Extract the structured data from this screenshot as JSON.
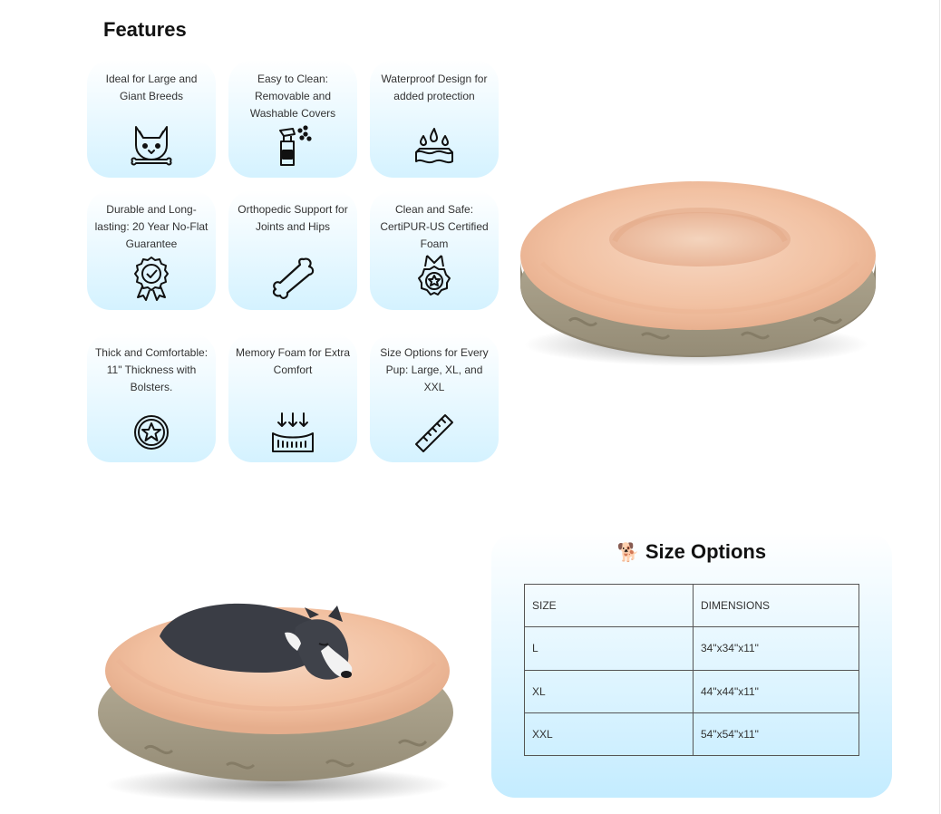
{
  "features": {
    "title": "Features",
    "items": [
      {
        "label": "Ideal for Large and Giant Breeds",
        "icon": "dog-with-bone-icon"
      },
      {
        "label": "Easy to Clean: Removable and Washable Covers",
        "icon": "spray-bottle-icon"
      },
      {
        "label": "Waterproof Design for added protection",
        "icon": "water-drops-icon"
      },
      {
        "label": "Durable and Long-lasting: 20 Year No-Flat Guarantee",
        "icon": "award-badge-icon"
      },
      {
        "label": "Orthopedic Support for Joints and Hips",
        "icon": "bone-icon"
      },
      {
        "label": "Clean and Safe: CertiPUR-US Certified Foam",
        "icon": "certified-medal-icon"
      },
      {
        "label": "Thick and Comfortable: 11\" Thickness with Bolsters.",
        "icon": "star-circle-icon"
      },
      {
        "label": "Memory Foam for Extra Comfort",
        "icon": "memory-foam-icon"
      },
      {
        "label": "Size Options for Every Pup: Large, XL, and XXL",
        "icon": "ruler-icon"
      }
    ]
  },
  "size_options": {
    "emoji": "🐕",
    "title": "Size Options",
    "header": [
      "SIZE",
      "DIMENSIONS"
    ],
    "rows": [
      [
        "L",
        "34\"x34\"x11\""
      ],
      [
        "XL",
        "44\"x44\"x11\""
      ],
      [
        "XXL",
        "54\"x54\"x11\""
      ]
    ]
  },
  "colors": {
    "card_gradient_top": "#ffffff",
    "card_gradient_bottom": "#d4f2ff",
    "fur": "#f3c4a6",
    "base": "#a9a08a"
  }
}
